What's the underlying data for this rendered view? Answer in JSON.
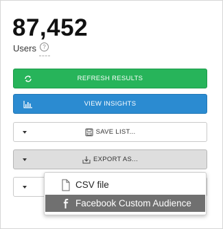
{
  "summary": {
    "count": "87,452",
    "label": "Users",
    "help_glyph": "?"
  },
  "actions": {
    "refresh_label": "REFRESH RESULTS",
    "insights_label": "VIEW INSIGHTS",
    "save_label": "SAVE LIST...",
    "export_label": "EXPORT AS..."
  },
  "export_menu": {
    "items": [
      {
        "label": "CSV file",
        "icon": "file-icon",
        "highlighted": false
      },
      {
        "label": "Facebook Custom Audience",
        "icon": "facebook-icon",
        "highlighted": true
      }
    ]
  },
  "colors": {
    "refresh": "#27b45a",
    "insights": "#2b8bd1",
    "highlight": "#707070"
  }
}
